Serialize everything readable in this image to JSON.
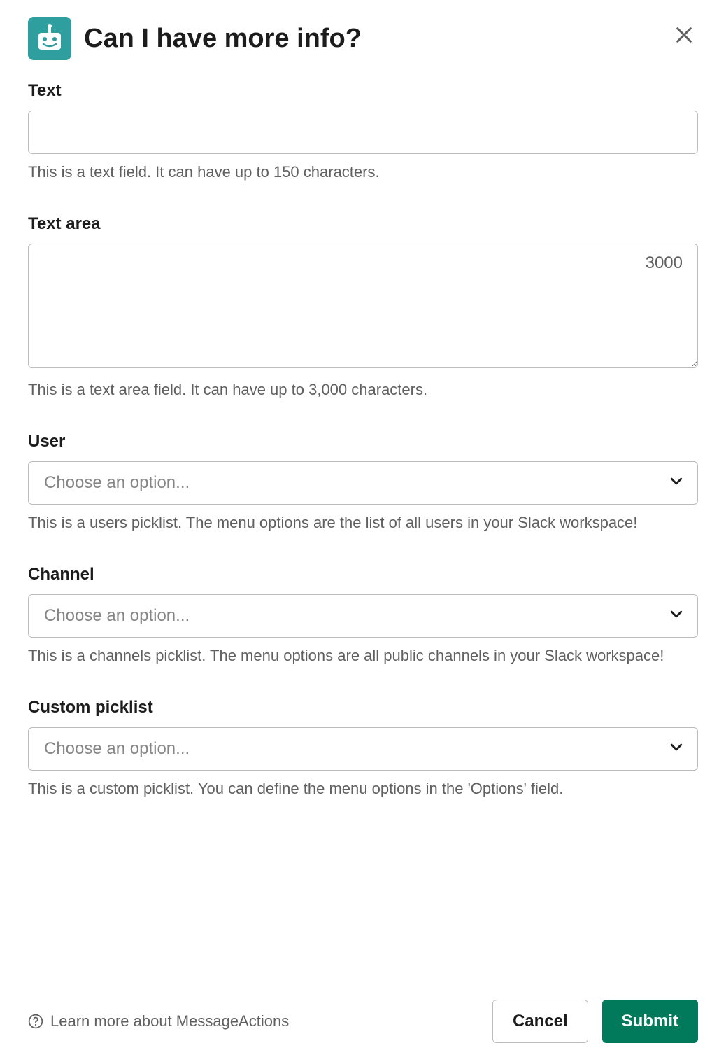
{
  "header": {
    "title": "Can I have more info?"
  },
  "fields": {
    "text": {
      "label": "Text",
      "value": "",
      "helper": "This is a text field. It can have up to 150 characters."
    },
    "textarea": {
      "label": "Text area",
      "value": "",
      "char_count": "3000",
      "helper": "This is a text area field. It can have up to 3,000 characters."
    },
    "user": {
      "label": "User",
      "placeholder": "Choose an option...",
      "helper": "This is a users picklist. The menu options are the list of all users in your Slack workspace!"
    },
    "channel": {
      "label": "Channel",
      "placeholder": "Choose an option...",
      "helper": "This is a channels picklist. The menu options are all public channels in your Slack workspace!"
    },
    "custom": {
      "label": "Custom picklist",
      "placeholder": "Choose an option...",
      "helper": "This is a custom picklist. You can define the menu options in the 'Options' field."
    }
  },
  "footer": {
    "help_text": "Learn more about MessageActions",
    "cancel_label": "Cancel",
    "submit_label": "Submit"
  }
}
